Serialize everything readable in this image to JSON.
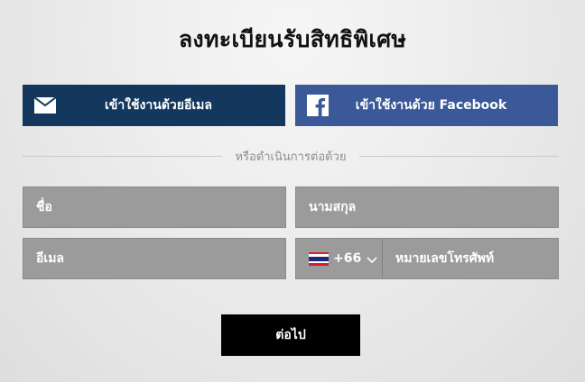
{
  "page": {
    "title": "ลงทะเบียนรับสิทธิพิเศษ"
  },
  "social": {
    "email_label": "เข้าใช้งานด้วยอีเมล",
    "email_icon": "envelope-icon",
    "email_color": "#14375e",
    "facebook_label": "เข้าใช้งานด้วย Facebook",
    "facebook_icon": "facebook-icon",
    "facebook_color": "#3b5998"
  },
  "divider": {
    "text": "หรือดำเนินการต่อด้วย"
  },
  "form": {
    "first_name_placeholder": "ชื่อ",
    "last_name_placeholder": "นามสกุล",
    "email_placeholder": "อีเมล",
    "country_flag": "thailand-flag-icon",
    "country_code": "+66",
    "phone_placeholder": "หมายเลขโทรศัพท์"
  },
  "actions": {
    "next_label": "ต่อไป",
    "next_color": "#000000"
  }
}
